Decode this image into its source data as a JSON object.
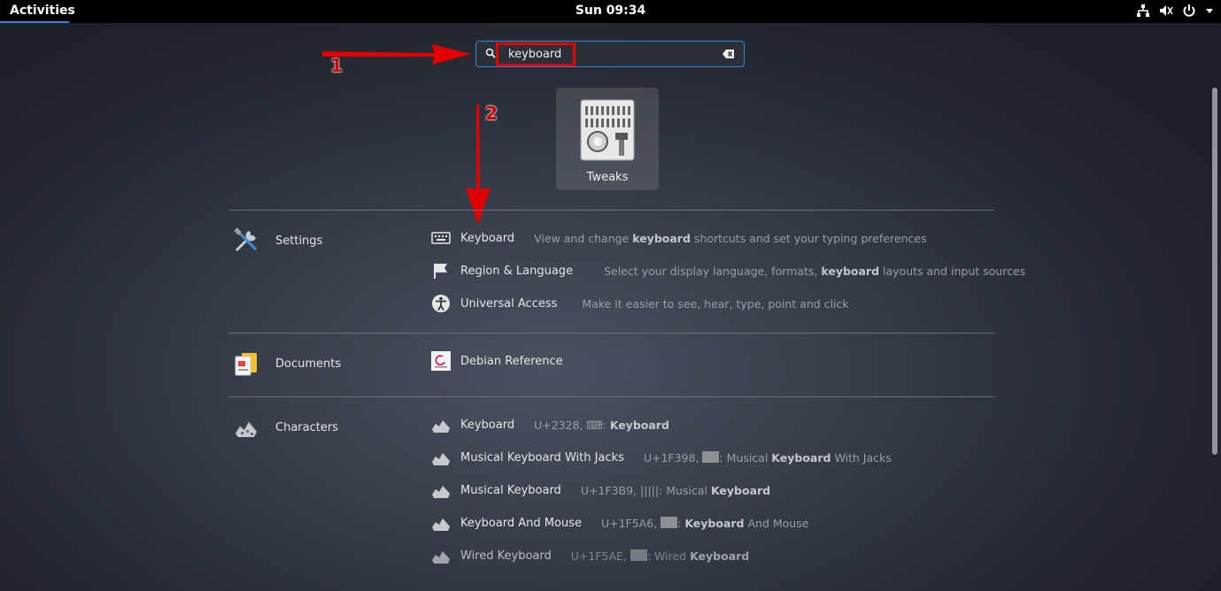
{
  "topbar": {
    "activities": "Activities",
    "clock": "Sun 09:34",
    "tray": {
      "network": "network-icon",
      "volume": "volume-icon",
      "power": "power-icon",
      "menu": "chevron-down-icon"
    }
  },
  "search": {
    "value": "keyboard",
    "placeholder": ""
  },
  "annotations": {
    "step1": "1",
    "step2": "2",
    "color": "#e00000"
  },
  "app_result": {
    "label": "Tweaks"
  },
  "providers": {
    "settings": {
      "name": "Settings",
      "results": [
        {
          "title": "Keyboard",
          "desc_pre": "View and change ",
          "desc_bold": "keyboard",
          "desc_post": " shortcuts and set your typing preferences"
        },
        {
          "title": "Region & Language",
          "desc_pre": "Select your display language, formats, ",
          "desc_bold": "keyboard",
          "desc_post": " layouts and input sources"
        },
        {
          "title": "Universal Access",
          "desc": "Make it easier to see, hear, type, point and click"
        }
      ]
    },
    "documents": {
      "name": "Documents",
      "results": [
        {
          "title": "Debian Reference"
        }
      ]
    },
    "characters": {
      "name": "Characters",
      "results": [
        {
          "title": "Keyboard",
          "code": "U+2328, ",
          "glyph": "⌨",
          "bold": "Keyboard"
        },
        {
          "title": "Musical Keyboard With Jacks",
          "code": "U+1F398, ",
          "pre": ": Musical ",
          "bold": "Keyboard",
          "post": " With Jacks"
        },
        {
          "title": "Musical Keyboard",
          "code": "U+1F3B9, ",
          "glyph": "|||||",
          "pre": ": Musical ",
          "bold": "Keyboard"
        },
        {
          "title": "Keyboard And Mouse",
          "code": "U+1F5A6, ",
          "pre": ": ",
          "bold": "Keyboard",
          "post": " And Mouse"
        },
        {
          "title": "Wired Keyboard",
          "code": "U+1F5AE, ",
          "pre": ": Wired ",
          "bold": "Keyboard"
        }
      ]
    }
  },
  "colors": {
    "accent": "#3584e4",
    "topbar": "#000000",
    "highlight": "#e00000"
  }
}
